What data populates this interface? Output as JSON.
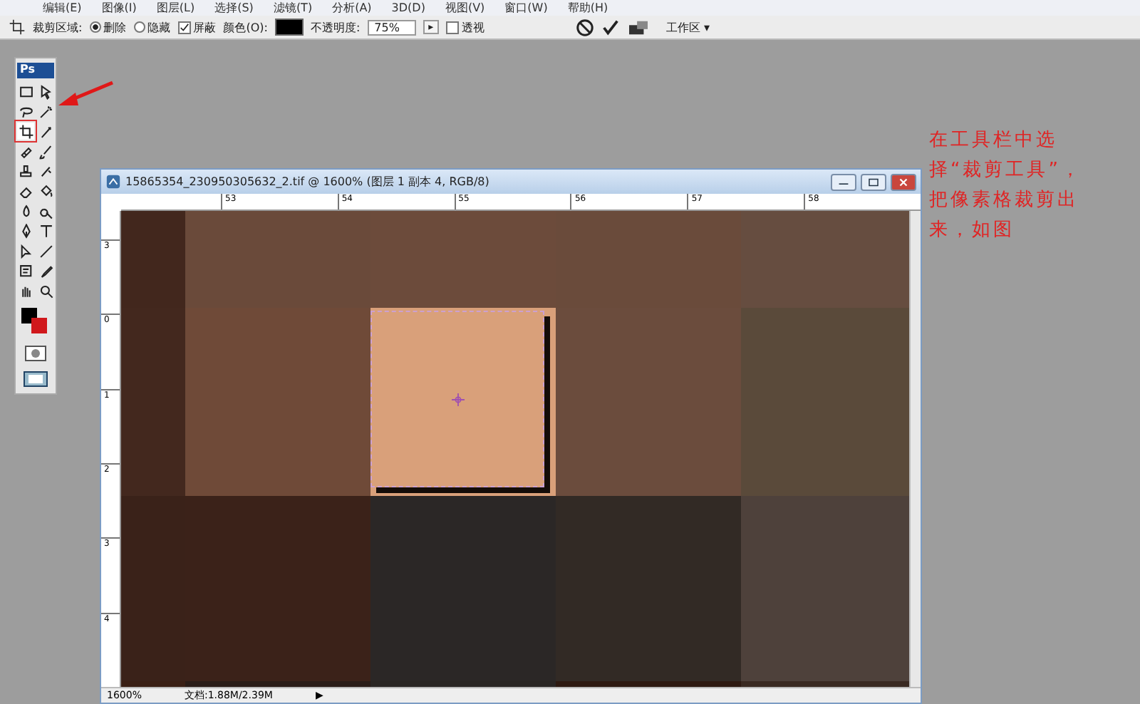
{
  "menu_bar": {
    "items": [
      "编辑(E)",
      "图像(I)",
      "图层(L)",
      "选择(S)",
      "滤镜(T)",
      "分析(A)",
      "3D(D)",
      "视图(V)",
      "窗口(W)",
      "帮助(H)"
    ]
  },
  "options_bar": {
    "crop_area_label": "裁剪区域:",
    "radios": [
      {
        "label": "删除",
        "selected": true
      },
      {
        "label": "隐藏",
        "selected": false
      }
    ],
    "shield": {
      "label": "屏蔽",
      "checked": true
    },
    "color_label": "颜色(O):",
    "opacity_label": "不透明度:",
    "opacity_value": "75%",
    "stepper": "▸",
    "perspective": {
      "label": "透视",
      "checked": false
    },
    "workspace": "工作区 ▾"
  },
  "toolbox": {
    "logo": "Ps",
    "tools": [
      {
        "kind": "marquee",
        "selected": false
      },
      {
        "kind": "move",
        "selected": false
      },
      {
        "kind": "lasso",
        "selected": false
      },
      {
        "kind": "wand",
        "selected": false
      },
      {
        "kind": "crop",
        "selected": true
      },
      {
        "kind": "slice",
        "selected": false
      },
      {
        "kind": "heal",
        "selected": false
      },
      {
        "kind": "brush",
        "selected": false
      },
      {
        "kind": "stamp",
        "selected": false
      },
      {
        "kind": "history",
        "selected": false
      },
      {
        "kind": "eraser",
        "selected": false
      },
      {
        "kind": "bucket",
        "selected": false
      },
      {
        "kind": "blur",
        "selected": false
      },
      {
        "kind": "dodge",
        "selected": false
      },
      {
        "kind": "pen",
        "selected": false
      },
      {
        "kind": "type",
        "selected": false
      },
      {
        "kind": "select",
        "selected": false
      },
      {
        "kind": "line",
        "selected": false
      },
      {
        "kind": "note",
        "selected": false
      },
      {
        "kind": "eyedropper",
        "selected": false
      },
      {
        "kind": "hand",
        "selected": false
      },
      {
        "kind": "zoom",
        "selected": false
      }
    ]
  },
  "document": {
    "title": "15865354_230950305632_2.tif @ 1600% (图层 1 副本 4, RGB/8)",
    "top_ruler": [
      "53",
      "54",
      "55",
      "56",
      "57",
      "58"
    ],
    "left_ruler": [
      "3",
      "0",
      "1",
      "2",
      "3",
      "4"
    ],
    "status": {
      "zoom": "1600%",
      "doc_size": "文档:1.88M/2.39M",
      "arrow": "▶"
    }
  },
  "annotation": "在工具栏中选择“裁剪工具”，把像素格裁剪出来，如图"
}
